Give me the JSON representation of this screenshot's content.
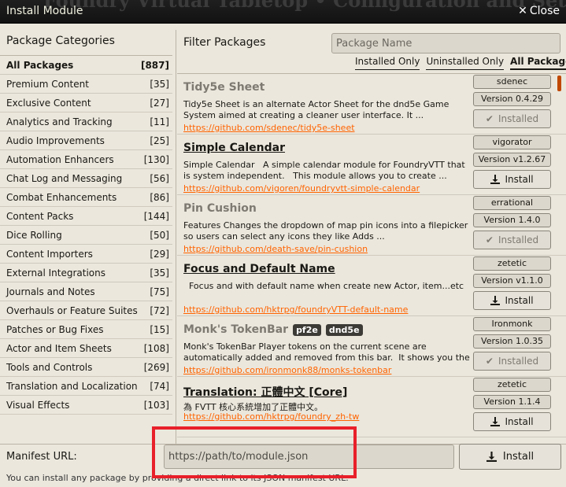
{
  "window": {
    "title": "Install Module",
    "background_title": "Foundry Virtual Tabletop • Configuration and Setup",
    "close_label": "Close"
  },
  "sidebar": {
    "heading": "Package Categories",
    "items": [
      {
        "label": "All Packages",
        "count": "[887]"
      },
      {
        "label": "Premium Content",
        "count": "[35]"
      },
      {
        "label": "Exclusive Content",
        "count": "[27]"
      },
      {
        "label": "Analytics and Tracking",
        "count": "[11]"
      },
      {
        "label": "Audio Improvements",
        "count": "[25]"
      },
      {
        "label": "Automation Enhancers",
        "count": "[130]"
      },
      {
        "label": "Chat Log and Messaging",
        "count": "[56]"
      },
      {
        "label": "Combat Enhancements",
        "count": "[86]"
      },
      {
        "label": "Content Packs",
        "count": "[144]"
      },
      {
        "label": "Dice Rolling",
        "count": "[50]"
      },
      {
        "label": "Content Importers",
        "count": "[29]"
      },
      {
        "label": "External Integrations",
        "count": "[35]"
      },
      {
        "label": "Journals and Notes",
        "count": "[75]"
      },
      {
        "label": "Overhauls or Feature Suites",
        "count": "[72]"
      },
      {
        "label": "Patches or Bug Fixes",
        "count": "[15]"
      },
      {
        "label": "Actor and Item Sheets",
        "count": "[108]"
      },
      {
        "label": "Tools and Controls",
        "count": "[269]"
      },
      {
        "label": "Translation and Localization",
        "count": "[74]"
      },
      {
        "label": "Visual Effects",
        "count": "[103]"
      }
    ]
  },
  "filter": {
    "label": "Filter Packages",
    "search_placeholder": "Package Name",
    "tabs": [
      "Installed Only",
      "Uninstalled Only",
      "All Packages"
    ]
  },
  "packages": [
    {
      "title": "Tidy5e Sheet",
      "description": "Tidy5e Sheet is an alternate Actor Sheet for the dnd5e Game System aimed at creating a cleaner user interface. It ...",
      "url": "https://github.com/sdenec/tidy5e-sheet",
      "author": "sdenec",
      "version": "Version 0.4.29",
      "button": "Installed"
    },
    {
      "title": "Simple Calendar",
      "description": "Simple Calendar   A simple calendar module for FoundryVTT that is system independent.   This module allows you to create ...",
      "url": "https://github.com/vigoren/foundryvtt-simple-calendar",
      "author": "vigorator",
      "version": "Version v1.2.67",
      "button": "Install"
    },
    {
      "title": "Pin Cushion",
      "description": "Features Changes the dropdown of map pin icons into a filepicker so users can select any icons they like Adds ...",
      "url": "https://github.com/death-save/pin-cushion",
      "author": "errational",
      "version": "Version 1.4.0",
      "button": "Installed"
    },
    {
      "title": "Focus and Default Name",
      "description": "  Focus and with default name when create new Actor, item...etc",
      "url": "https://github.com/hktrpg/foundryVTT-default-name",
      "author": "zetetic",
      "version": "Version v1.1.0",
      "button": "Install"
    },
    {
      "title": "Monk's TokenBar",
      "tags": [
        "pf2e",
        "dnd5e"
      ],
      "description": "Monk's TokenBar Player tokens on the current scene are automatically added and removed from this bar.  It shows you the ...",
      "url": "https://github.com/ironmonk88/monks-tokenbar",
      "author": "Ironmonk",
      "version": "Version 1.0.35",
      "button": "Installed"
    },
    {
      "title": "Translation: 正體中文 [Core]",
      "description": "為 FVTT 核心系統增加了正體中文。",
      "url": "https://github.com/hktrpg/foundry_zh-tw",
      "author": "zetetic",
      "version": "Version 1.1.4",
      "button": "Install"
    }
  ],
  "footer": {
    "manifest_label": "Manifest URL:",
    "manifest_placeholder": "https://path/to/module.json",
    "install_label": "Install",
    "hint": "You can install any package by providing a direct link to its JSON manifest URL."
  },
  "colors": {
    "link": "#ff6400",
    "highlight": "#e8202a",
    "scrollbar": "#c04800"
  }
}
